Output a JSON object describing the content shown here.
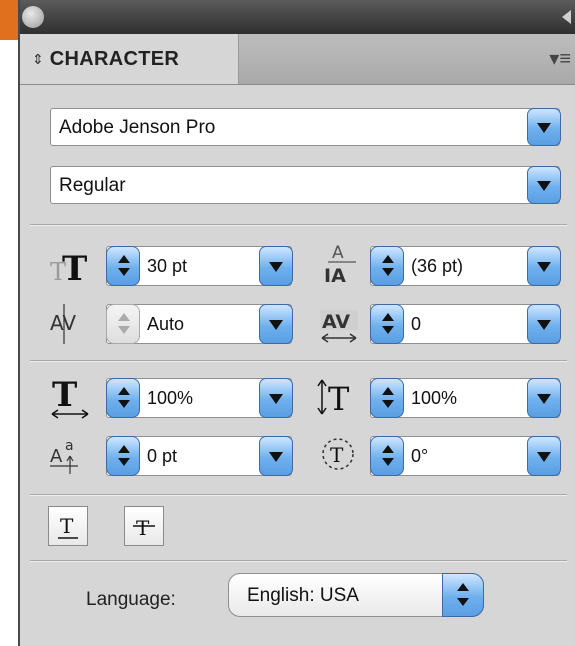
{
  "panel": {
    "tab_label": "CHARACTER",
    "accent_color": "#e0701e"
  },
  "font": {
    "family": "Adobe Jenson Pro",
    "style": "Regular"
  },
  "size_section": {
    "font_size": "30 pt",
    "leading": "(36 pt)",
    "kerning": "Auto",
    "tracking": "0"
  },
  "scale_section": {
    "horizontal_scale": "100%",
    "vertical_scale": "100%",
    "baseline_shift": "0 pt",
    "rotation": "0°"
  },
  "styles": {
    "underline_icon": "underline-icon",
    "strikethrough_icon": "strikethrough-icon"
  },
  "language": {
    "label": "Language:",
    "value": "English: USA"
  }
}
